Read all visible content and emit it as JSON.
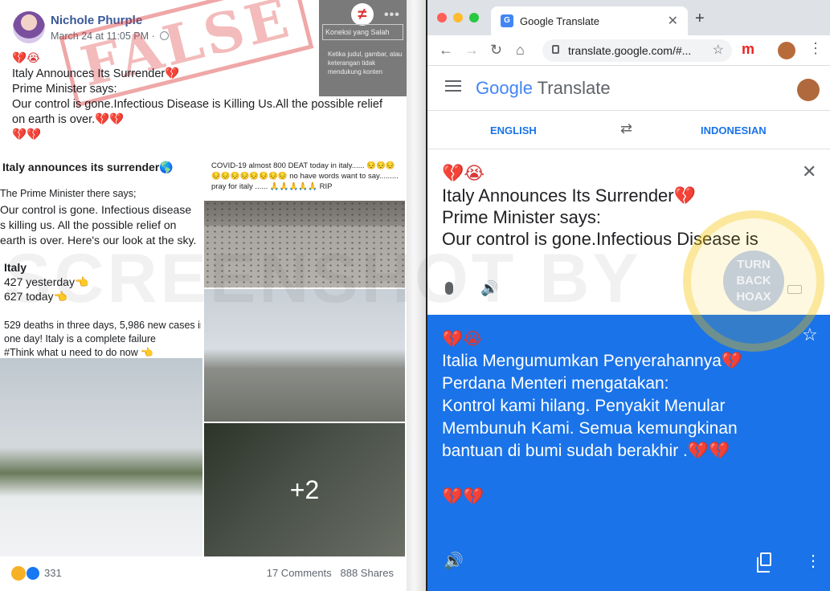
{
  "facebook_post": {
    "author": "Nichole Phurple",
    "timestamp": "March 24 at 11:05 PM · ",
    "stamp": "FALSE",
    "hoax_card": {
      "title": "Koneksi yang Salah",
      "description": "Ketika judul, gambar, atau keterangan tidak mendukung konten"
    },
    "text_lines": [
      "💔😭",
      "Italy Announces Its Surrender💔",
      "Prime Minister says:",
      "Our control is gone.Infectious Disease is Killing Us.All the possible relief",
      "on earth is over.💔💔",
      "💔💔"
    ],
    "image1": {
      "title": "Italy announces its surrender🌎",
      "line1": "The Prime Minister there says;",
      "line2": "Our control is gone. Infectious disease",
      "line3": "s killing us.  All the possible relief on",
      "line4": "earth is over. Here's our look at the sky.",
      "italy_label": "Italy",
      "yesterday": "427 yesterday👈",
      "today": "627 today👈",
      "stats1": "529 deaths in three days, 5,986 new cases in",
      "stats2": "one day!  Italy is a complete failure",
      "stats3": "#Think what u need to do now 👈"
    },
    "image2_caption": "COVID-19 almost 800 DEAT today in italy...... 😔😔😔 😔😔😔😔😔😔😔😔 no have words want to say......... pray for italy ...... 🙏🙏🙏🙏🙏 RIP",
    "more_photos": "+2",
    "reactions_count": "331",
    "comments": "17 Comments",
    "shares": "888 Shares"
  },
  "browser": {
    "tab_title": "Google Translate",
    "url": "translate.google.com/#...",
    "extension_letter": "m"
  },
  "translate": {
    "logo": "Google",
    "product": "Translate",
    "source_lang": "ENGLISH",
    "target_lang": "INDONESIAN",
    "source_lines": [
      "💔😭",
      "Italy Announces Its Surrender💔",
      "Prime Minister says:",
      "Our control is gone.Infectious Disease is"
    ],
    "target_lines": [
      "💔😭",
      "Italia Mengumumkan Penyerahannya💔",
      "Perdana Menteri mengatakan:",
      "Kontrol kami hilang. Penyakit Menular",
      "Membunuh Kami. Semua kemungkinan",
      "bantuan di bumi sudah berakhir .💔💔",
      "",
      "💔💔"
    ]
  },
  "watermark": "SCREENSHOT BY",
  "seal": "TURN BACK HOAX",
  "icons": [
    "globe-icon",
    "more-icon",
    "not-equal-icon",
    "lock-icon",
    "star-icon",
    "mic-icon",
    "speaker-icon",
    "copy-icon",
    "swap-icon",
    "close-icon",
    "menu-icon"
  ]
}
